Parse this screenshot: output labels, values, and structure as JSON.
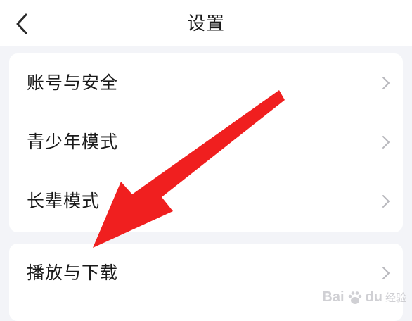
{
  "header": {
    "title": "设置",
    "back_icon": "chevron-left-icon"
  },
  "settings": {
    "group1": [
      {
        "label": "账号与安全"
      },
      {
        "label": "青少年模式"
      },
      {
        "label": "长辈模式"
      }
    ],
    "group2": [
      {
        "label": "播放与下载"
      }
    ]
  },
  "annotation": {
    "arrow_color": "#f01f1f"
  },
  "watermark": {
    "brand": "Bai",
    "brand_tail": "du",
    "suffix": "经验"
  },
  "colors": {
    "background": "#f3f4f8",
    "card": "#ffffff",
    "chevron": "#b8b8bd",
    "text": "#1a1a1a"
  }
}
